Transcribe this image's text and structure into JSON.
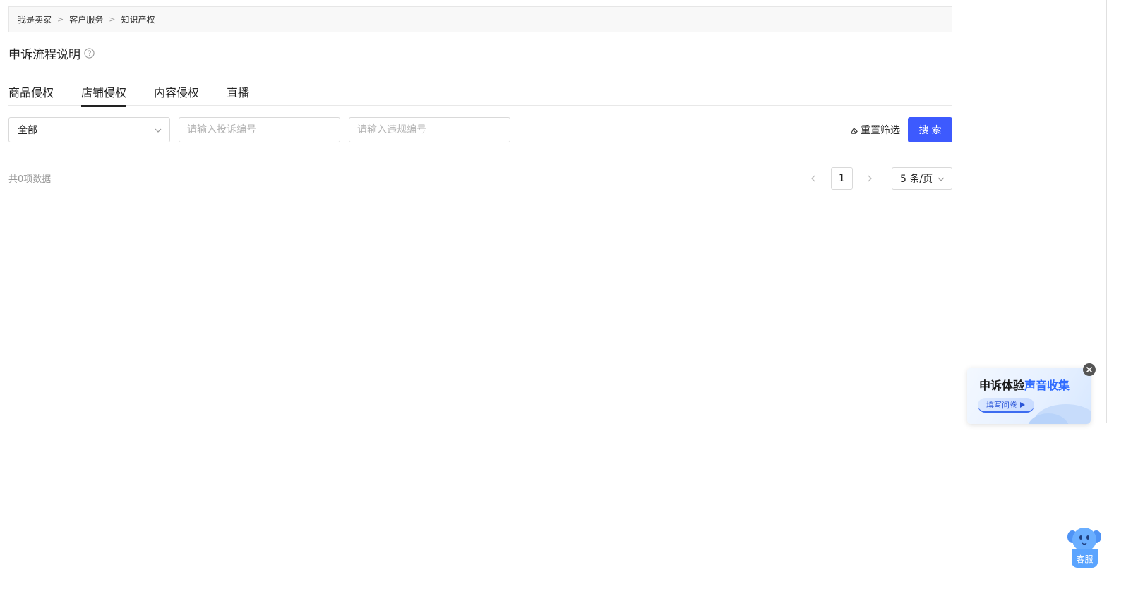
{
  "breadcrumb": {
    "items": [
      "我是卖家",
      "客户服务",
      "知识产权"
    ],
    "separator": ">"
  },
  "page": {
    "title": "申诉流程说明",
    "help_icon": "question-circle-icon"
  },
  "tabs": [
    {
      "label": "商品侵权",
      "active": false
    },
    {
      "label": "店铺侵权",
      "active": true
    },
    {
      "label": "内容侵权",
      "active": false
    },
    {
      "label": "直播",
      "active": false
    }
  ],
  "filters": {
    "type_select": {
      "value": "全部",
      "icon": "chevron-down-icon"
    },
    "complaint_no": {
      "placeholder": "请输入投诉编号",
      "value": ""
    },
    "violation_no": {
      "placeholder": "请输入违规编号",
      "value": ""
    },
    "reset_label": "重置筛选",
    "reset_icon": "eraser-icon",
    "search_label": "搜索"
  },
  "results": {
    "total_text": "共0项数据"
  },
  "pagination": {
    "current_page": "1",
    "page_size_label": "5 条/页",
    "prev_icon": "chevron-left-icon",
    "next_icon": "chevron-right-icon"
  },
  "survey": {
    "title_prefix": "申诉体验",
    "title_highlight": "声音收集",
    "button_label": "填写问卷",
    "close_icon": "close-icon"
  },
  "customer_service": {
    "label": "客服",
    "icon": "mascot-icon"
  },
  "colors": {
    "primary": "#3d5afe",
    "survey_highlight": "#2f6bff",
    "cs_blue": "#5aa4ff"
  }
}
